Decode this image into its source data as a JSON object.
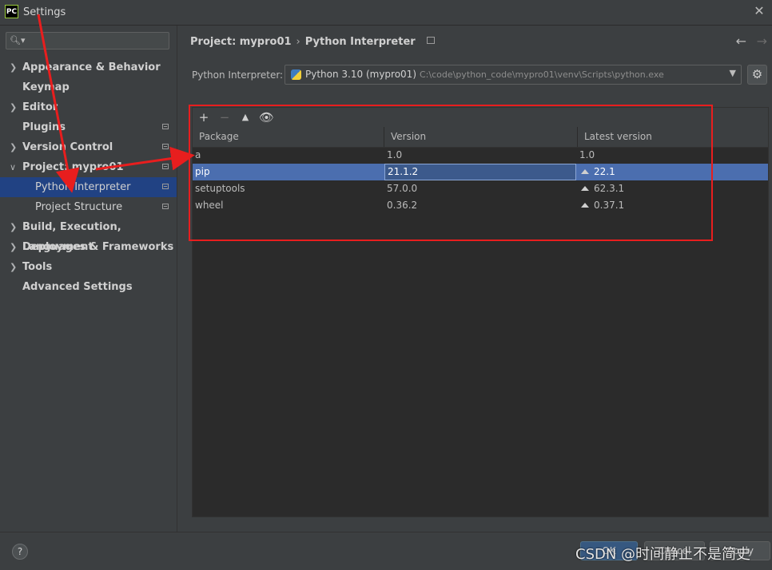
{
  "window": {
    "title": "Settings",
    "logo": "PC"
  },
  "sidebar": {
    "search_placeholder": "",
    "items": [
      {
        "label": "Appearance & Behavior",
        "expandable": true,
        "expanded": false
      },
      {
        "label": "Keymap",
        "expandable": false
      },
      {
        "label": "Editor",
        "expandable": true,
        "expanded": false
      },
      {
        "label": "Plugins",
        "expandable": false,
        "pinned": true
      },
      {
        "label": "Version Control",
        "expandable": true,
        "expanded": false,
        "pinned": true
      },
      {
        "label": "Project: mypro01",
        "expandable": true,
        "expanded": true,
        "pinned": true
      },
      {
        "label": "Python Interpreter",
        "child": true,
        "selected": true,
        "pinned": true
      },
      {
        "label": "Project Structure",
        "child": true,
        "pinned": true
      },
      {
        "label": "Build, Execution, Deployment",
        "expandable": true,
        "expanded": false
      },
      {
        "label": "Languages & Frameworks",
        "expandable": true,
        "expanded": false
      },
      {
        "label": "Tools",
        "expandable": true,
        "expanded": false
      },
      {
        "label": "Advanced Settings",
        "expandable": false
      }
    ]
  },
  "breadcrumb": {
    "project": "Project: mypro01",
    "page": "Python Interpreter"
  },
  "interpreter": {
    "label": "Python Interpreter:",
    "name": "Python 3.10 (mypro01)",
    "path": "C:\\code\\python_code\\mypro01\\venv\\Scripts\\python.exe"
  },
  "packages": {
    "columns": [
      "Package",
      "Version",
      "Latest version"
    ],
    "rows": [
      {
        "package": "a",
        "version": "1.0",
        "latest": "1.0",
        "upgrade": false
      },
      {
        "package": "pip",
        "version": "21.1.2",
        "latest": "22.1",
        "upgrade": true,
        "selected": true
      },
      {
        "package": "setuptools",
        "version": "57.0.0",
        "latest": "62.3.1",
        "upgrade": true
      },
      {
        "package": "wheel",
        "version": "0.36.2",
        "latest": "0.37.1",
        "upgrade": true
      }
    ]
  },
  "footer": {
    "help": "?",
    "ok": "OK",
    "cancel": "Cancel",
    "apply": "Apply"
  },
  "watermark": "CSDN @时间静止不是简史",
  "colors": {
    "selection": "#2f65ca",
    "annotation": "#e81e1e",
    "background": "#3c3f41"
  }
}
